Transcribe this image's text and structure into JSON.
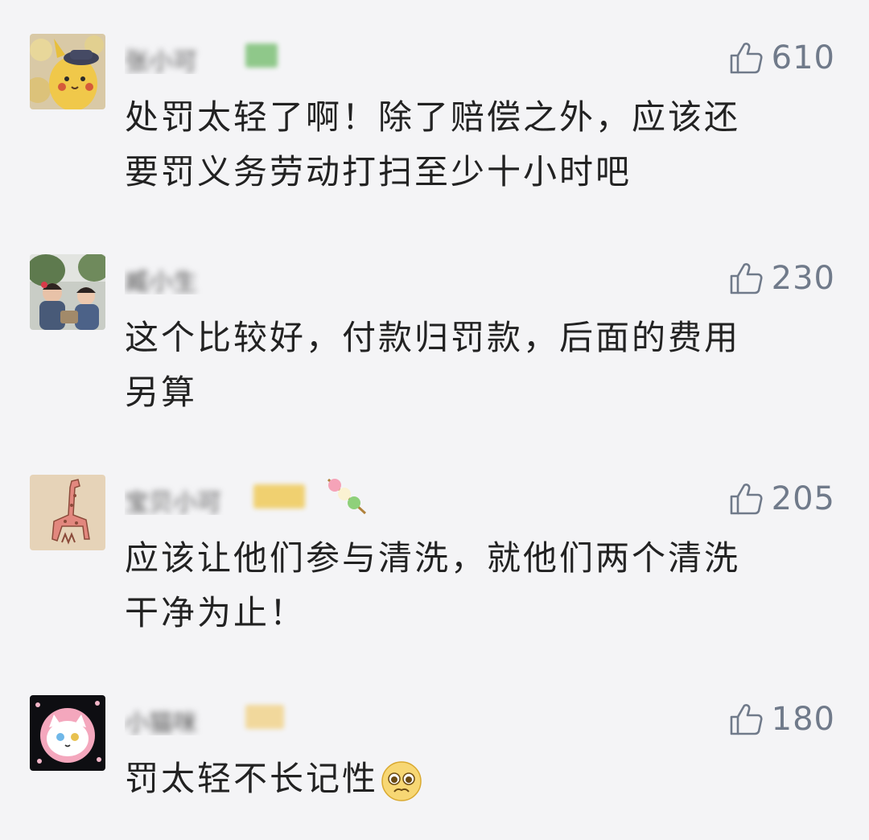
{
  "comments": [
    {
      "username": "张小可",
      "likes": "610",
      "text_lines": [
        "处罚太轻了啊！除了赔偿之外，应该还",
        "要罚义务劳动打扫至少十小时吧"
      ],
      "avatar": "pikachu-plush-avatar"
    },
    {
      "username": "臧小生",
      "likes": "230",
      "text_lines": [
        "这个比较好，付款归罚款，后面的费用",
        "另算"
      ],
      "avatar": "children-photo-avatar"
    },
    {
      "username": "宝贝小可",
      "likes": "205",
      "text_lines": [
        "应该让他们参与清洗，就他们两个清洗",
        "干净为止！"
      ],
      "avatar": "giraffe-drawing-avatar"
    },
    {
      "username": "小猫咪",
      "likes": "180",
      "text_lines": [
        "罚太轻不长记性"
      ],
      "avatar": "cartoon-cat-avatar",
      "emoji": "pleading-face-emoji"
    }
  ],
  "icons": {
    "like": "thumbs-up-icon"
  },
  "colors": {
    "background": "#f4f4f6",
    "text": "#222222",
    "like": "#707a8a"
  }
}
